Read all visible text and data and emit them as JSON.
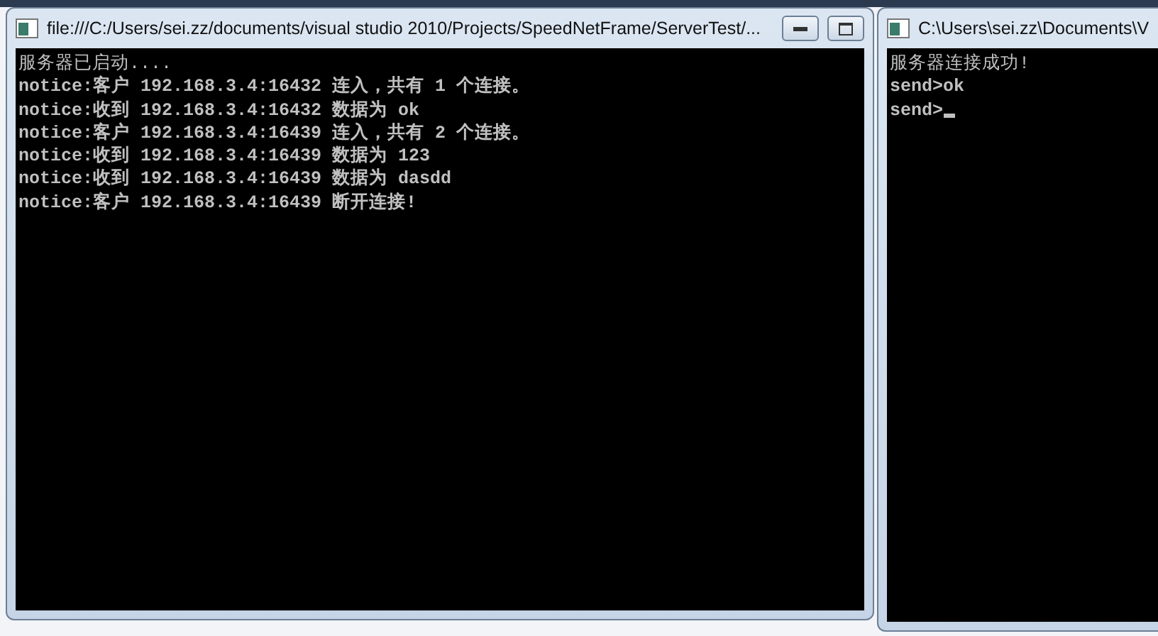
{
  "windows": [
    {
      "title": "file:///C:/Users/sei.zz/documents/visual studio 2010/Projects/SpeedNetFrame/ServerTest/...",
      "show_controls": true,
      "cursor": false,
      "lines": [
        {
          "kind": "plain",
          "text": "服务器已启动...."
        },
        {
          "kind": "bold",
          "text": "notice:客户 192.168.3.4:16432 连入，共有 1 个连接。"
        },
        {
          "kind": "bold",
          "text": "notice:收到 192.168.3.4:16432 数据为 ok"
        },
        {
          "kind": "bold",
          "text": "notice:客户 192.168.3.4:16439 连入，共有 2 个连接。"
        },
        {
          "kind": "bold",
          "text": "notice:收到 192.168.3.4:16439 数据为 123"
        },
        {
          "kind": "bold",
          "text": "notice:收到 192.168.3.4:16439 数据为 dasdd"
        },
        {
          "kind": "bold",
          "text": "notice:客户 192.168.3.4:16439 断开连接!"
        }
      ]
    },
    {
      "title": "C:\\Users\\sei.zz\\Documents\\V",
      "show_controls": false,
      "cursor": true,
      "lines": [
        {
          "kind": "plain",
          "text": "服务器连接成功!"
        },
        {
          "kind": "bold",
          "text": "send>ok"
        },
        {
          "kind": "bold",
          "text": "send>"
        }
      ]
    }
  ]
}
